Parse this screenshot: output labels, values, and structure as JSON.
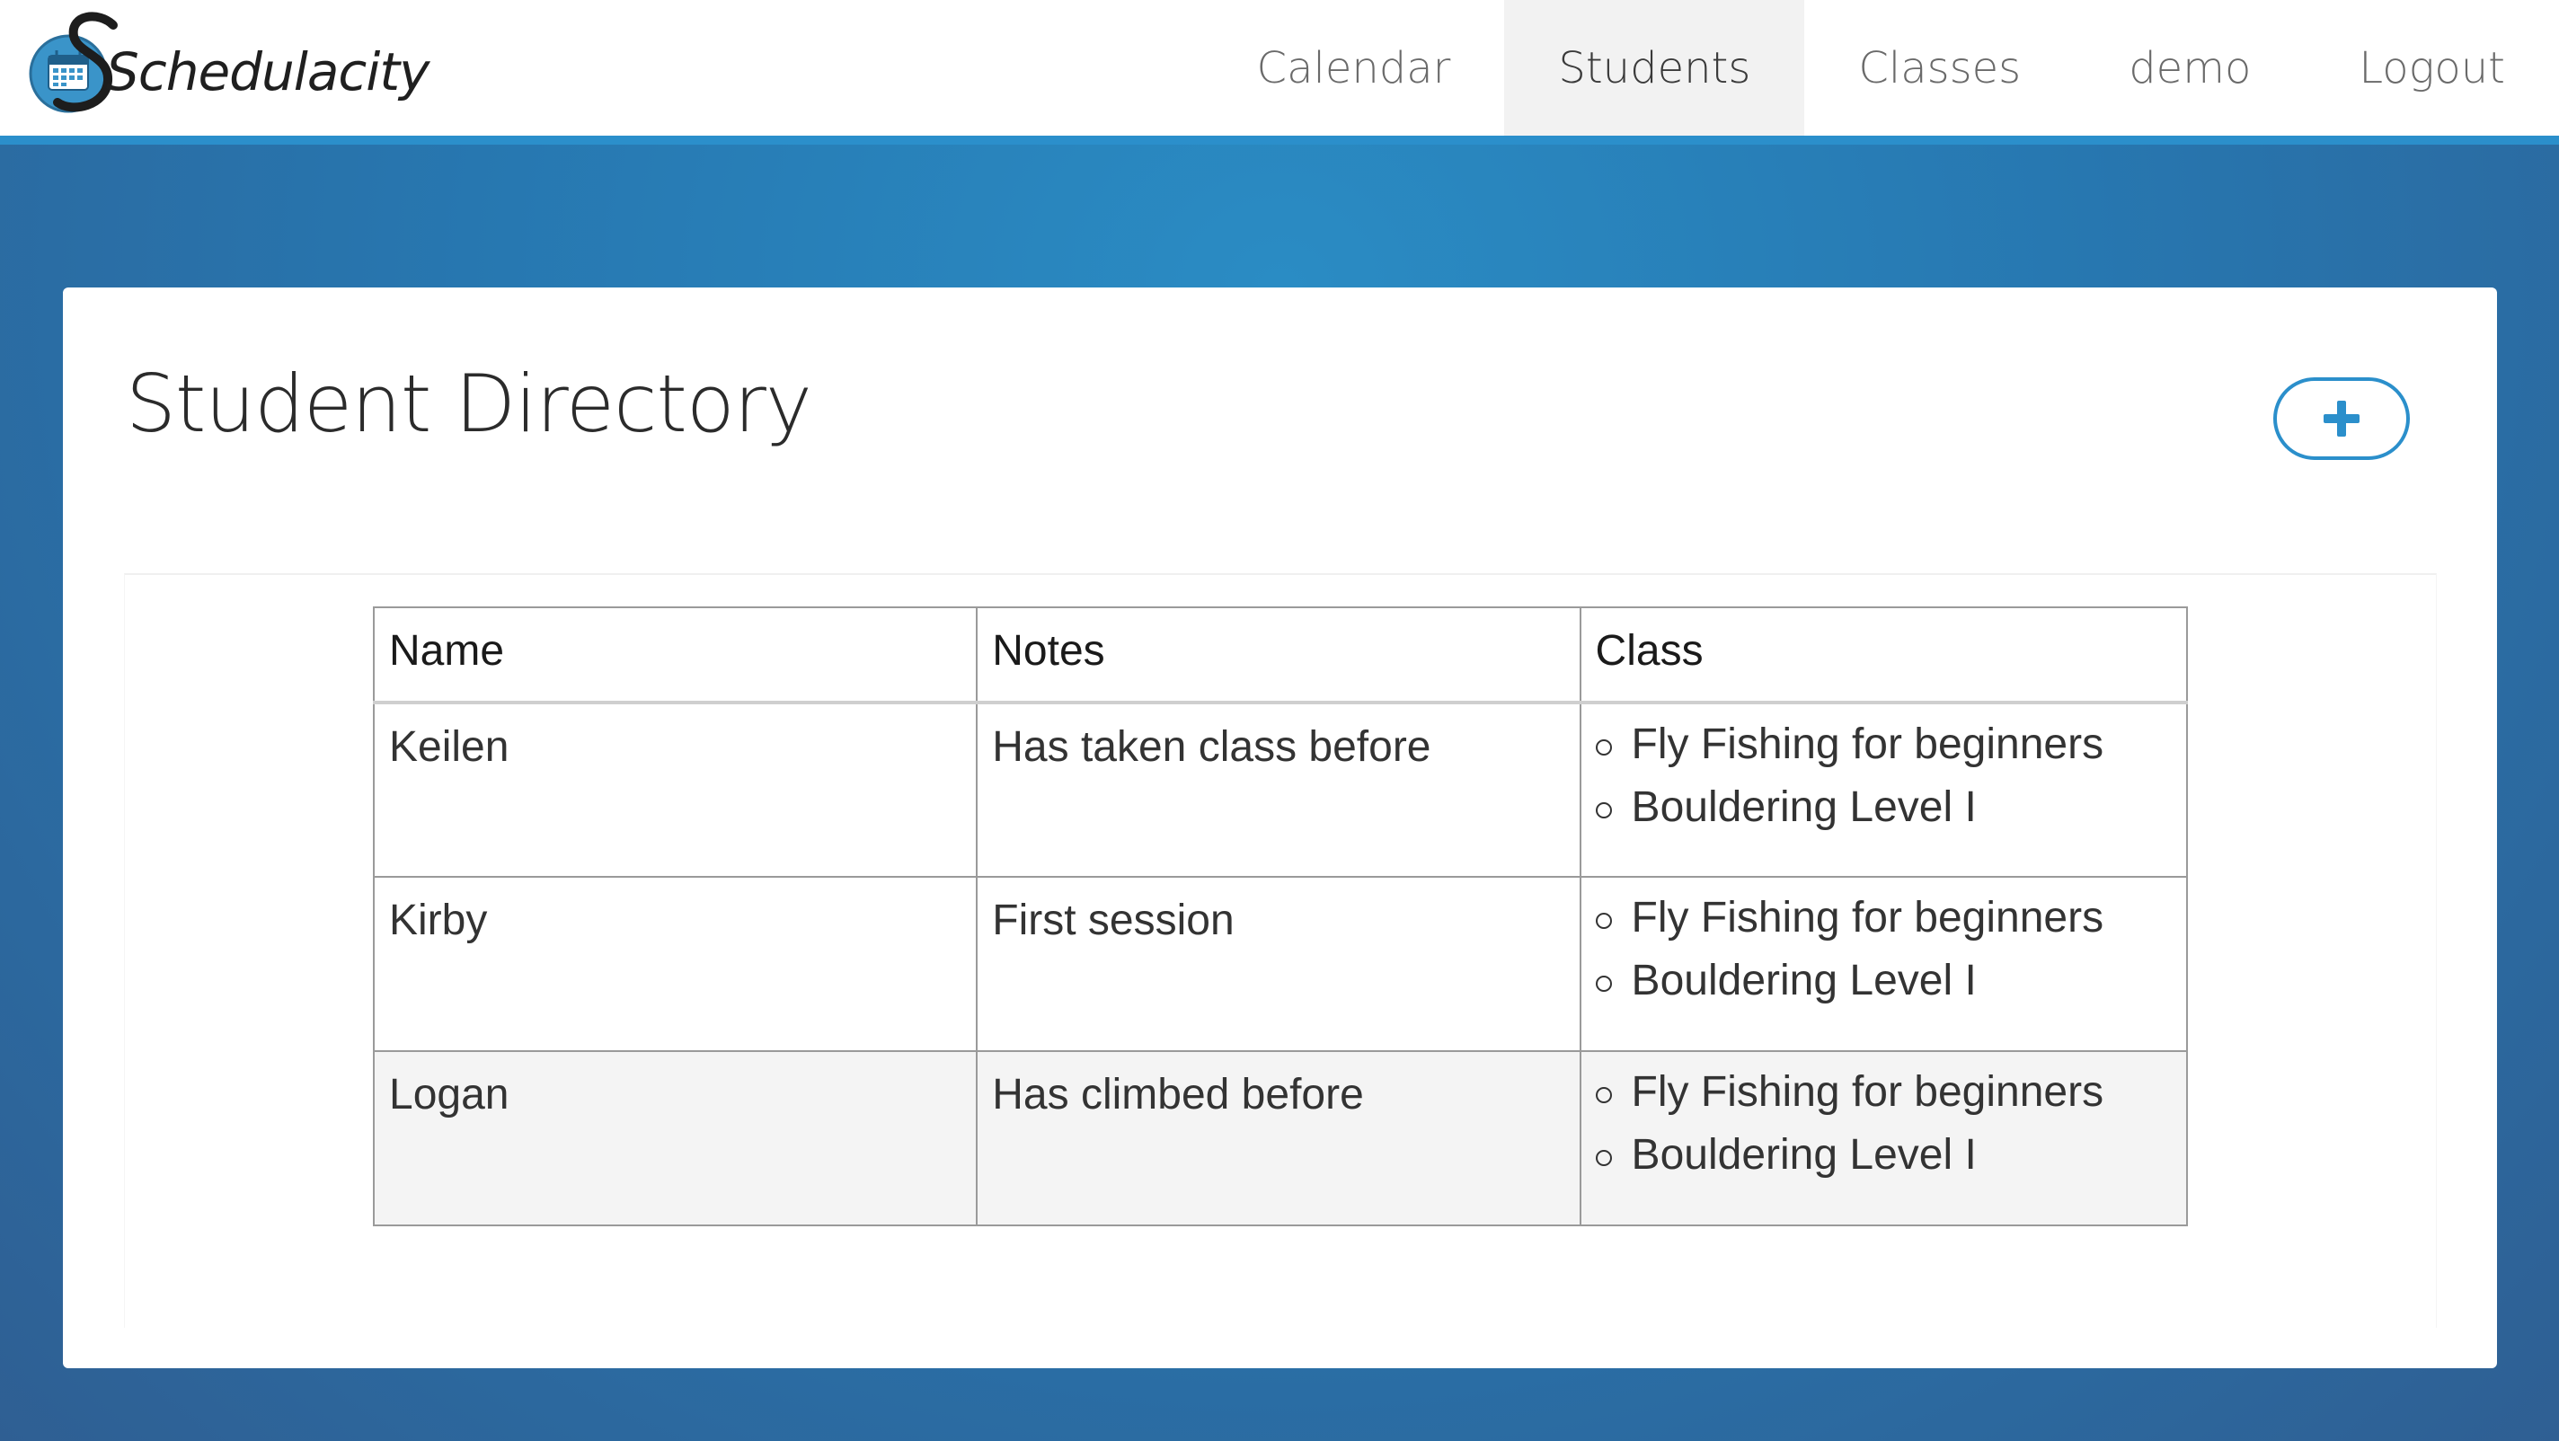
{
  "app": {
    "brand_name": "Schedulacity",
    "brand_color": "#2b8fcb",
    "logo_icon": "calendar-icon"
  },
  "nav": {
    "items": [
      {
        "label": "Calendar",
        "active": false
      },
      {
        "label": "Students",
        "active": true
      },
      {
        "label": "Classes",
        "active": false
      },
      {
        "label": "demo",
        "active": false
      },
      {
        "label": "Logout",
        "active": false
      }
    ]
  },
  "page": {
    "title": "Student Directory",
    "add_button_icon": "plus-icon"
  },
  "table": {
    "headers": [
      "Name",
      "Notes",
      "Class"
    ],
    "rows": [
      {
        "name": "Keilen",
        "notes": "Has taken class before",
        "classes": [
          "Fly Fishing for beginners",
          "Bouldering Level I"
        ]
      },
      {
        "name": "Kirby",
        "notes": "First session",
        "classes": [
          "Fly Fishing for beginners",
          "Bouldering Level I"
        ]
      },
      {
        "name": "Logan",
        "notes": "Has climbed before",
        "classes": [
          "Fly Fishing for beginners",
          "Bouldering Level I"
        ]
      }
    ]
  }
}
